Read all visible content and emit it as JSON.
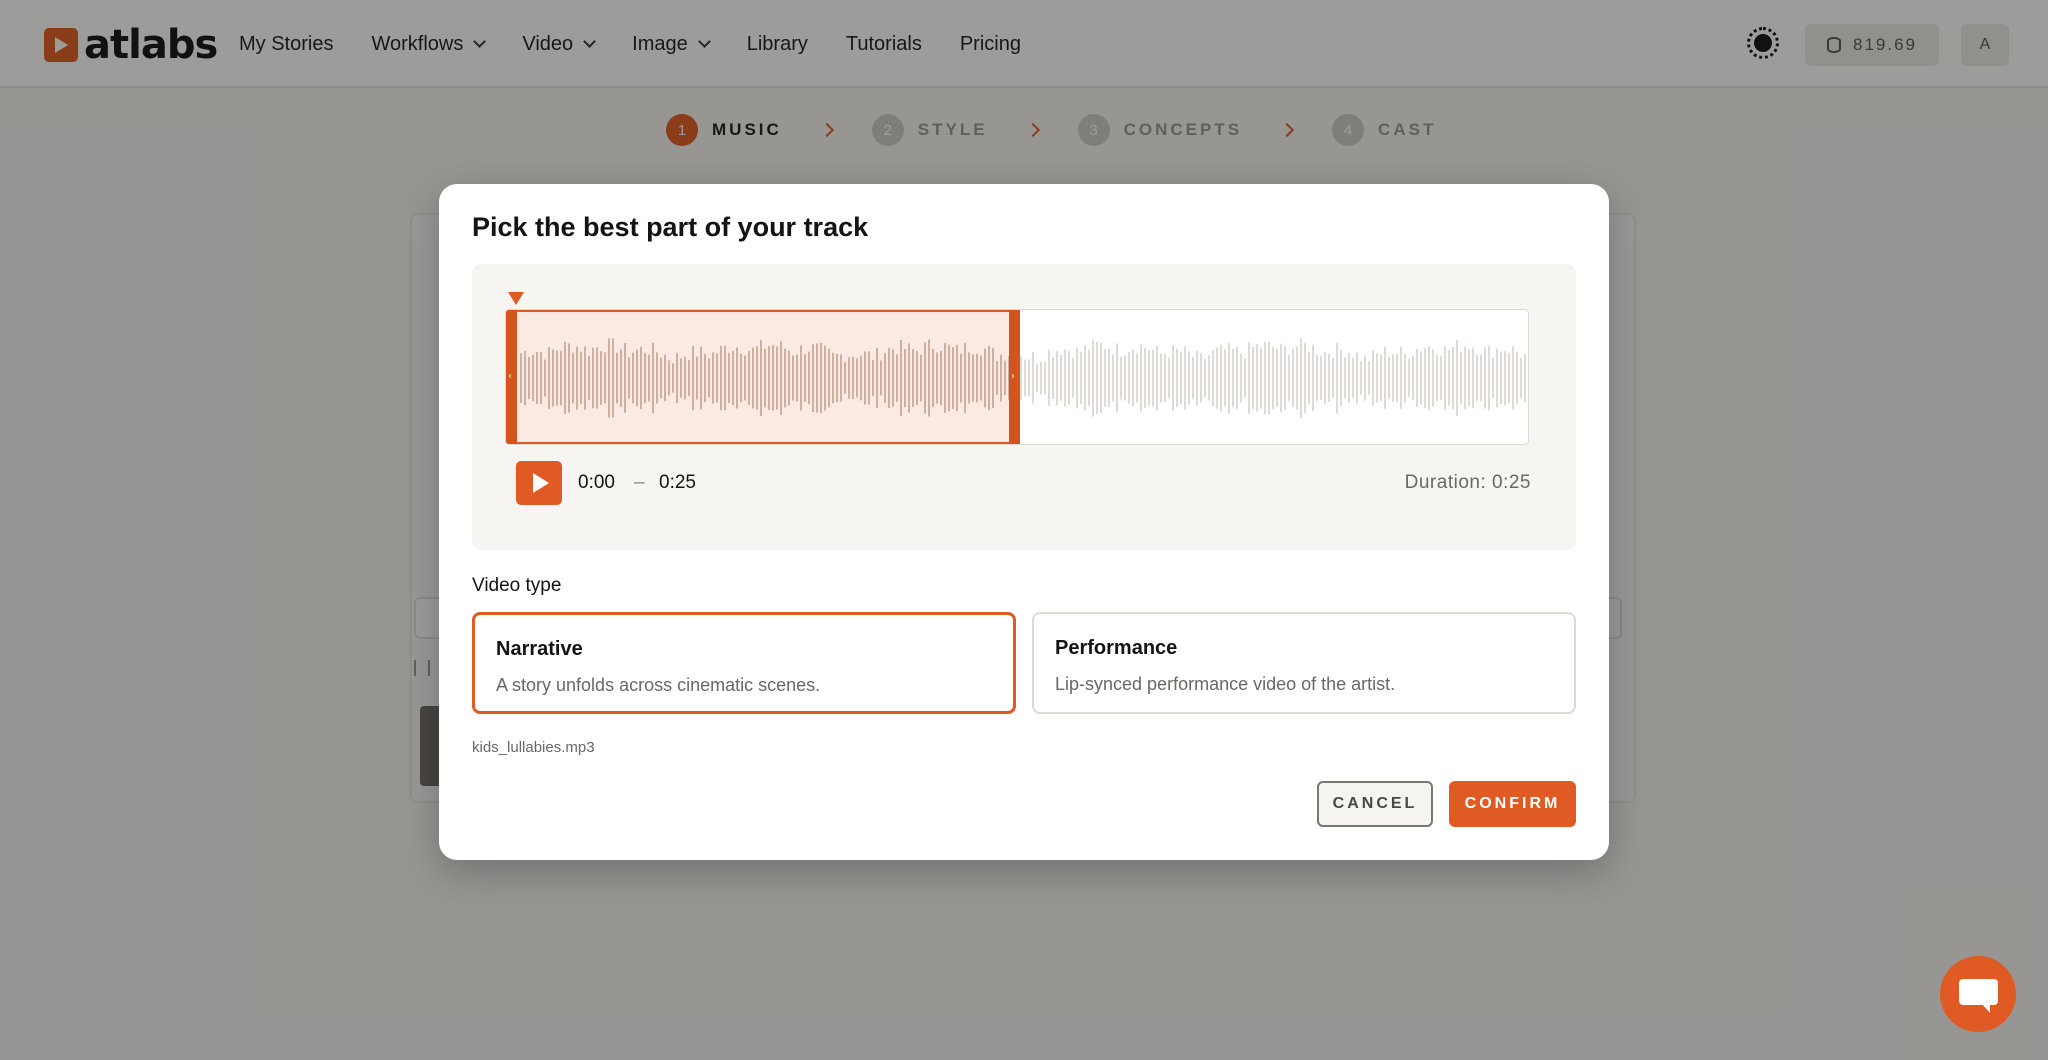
{
  "app": {
    "logo_text": "atlabs",
    "nav": [
      {
        "label": "My Stories",
        "has_dropdown": false
      },
      {
        "label": "Workflows",
        "has_dropdown": true
      },
      {
        "label": "Video",
        "has_dropdown": true
      },
      {
        "label": "Image",
        "has_dropdown": true
      },
      {
        "label": "Library",
        "has_dropdown": false
      },
      {
        "label": "Tutorials",
        "has_dropdown": false
      },
      {
        "label": "Pricing",
        "has_dropdown": false
      }
    ],
    "credits": "819.69",
    "avatar_initial": "A"
  },
  "steps": [
    {
      "num": "1",
      "label": "MUSIC",
      "active": true
    },
    {
      "num": "2",
      "label": "STYLE",
      "active": false
    },
    {
      "num": "3",
      "label": "CONCEPTS",
      "active": false
    },
    {
      "num": "4",
      "label": "CAST",
      "active": false
    }
  ],
  "modal": {
    "title": "Pick the best part of your track",
    "player": {
      "start_time": "0:00",
      "separator": "–",
      "end_time": "0:25",
      "duration_label": "Duration: 0:25",
      "selection_fraction": 0.5,
      "playhead_fraction": 0.0
    },
    "video_type_label": "Video type",
    "video_types": [
      {
        "title": "Narrative",
        "description": "A story unfolds across cinematic scenes.",
        "selected": true
      },
      {
        "title": "Performance",
        "description": "Lip-synced performance video of the artist.",
        "selected": false
      }
    ],
    "filename": "kids_lullabies.mp3",
    "cancel_label": "CANCEL",
    "confirm_label": "CONFIRM"
  },
  "colors": {
    "accent": "#e05a23",
    "wave_selected": "#c9beb6",
    "wave_unselected": "#dedad6"
  },
  "icons": {
    "theme_toggle": "sun-icon",
    "credits": "database-icon",
    "play": "play-icon",
    "chat": "chat-bubble-icon"
  }
}
